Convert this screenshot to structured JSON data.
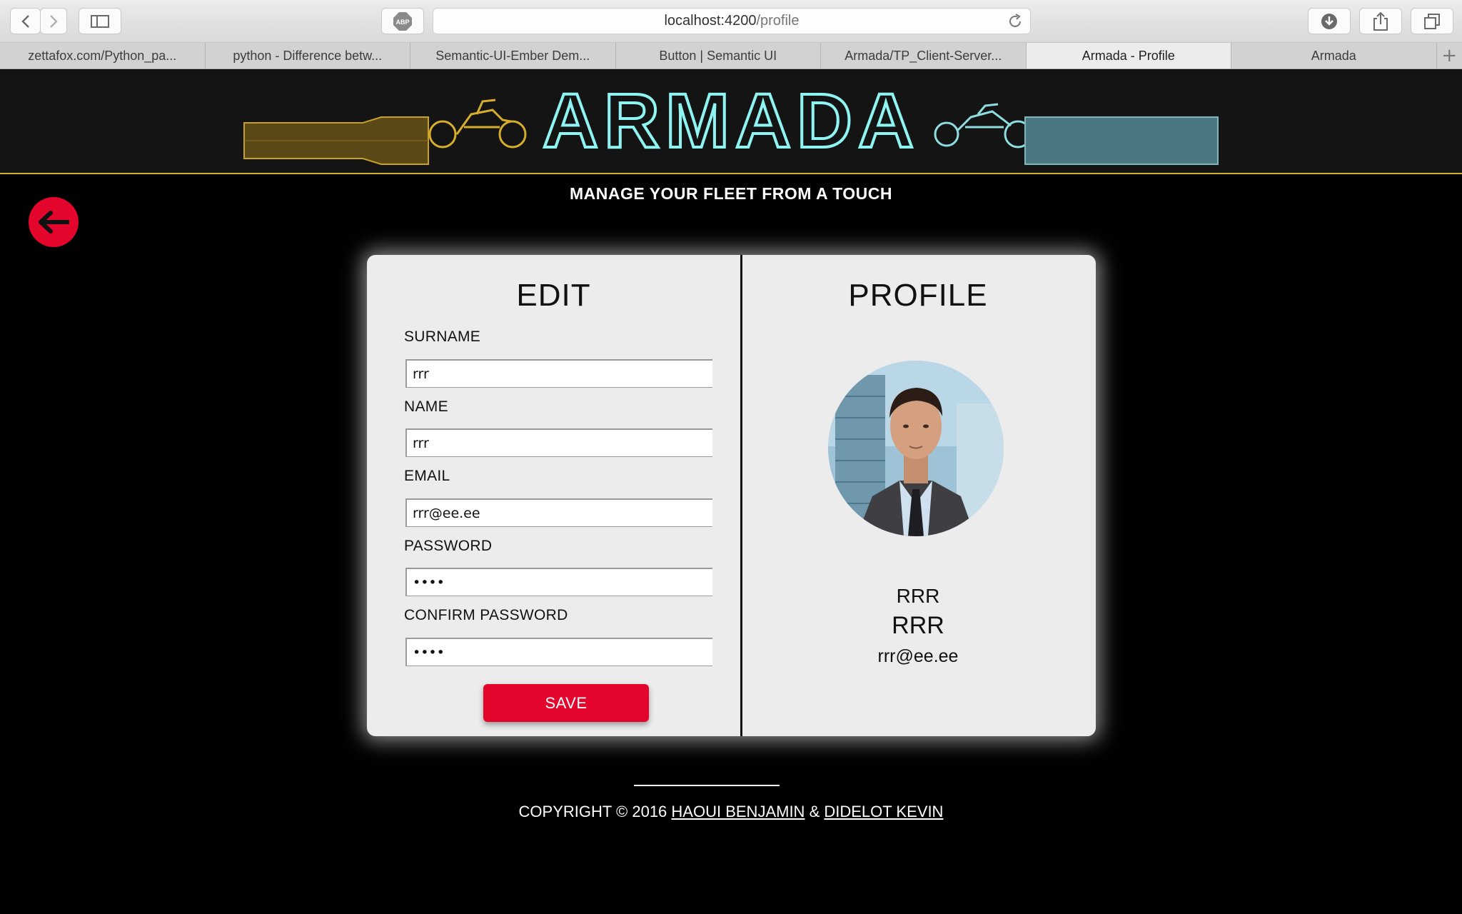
{
  "browser": {
    "url_host": "localhost:4200",
    "url_path": "/profile",
    "tabs": [
      {
        "label": "zettafox.com/Python_pa..."
      },
      {
        "label": "python - Difference betw..."
      },
      {
        "label": "Semantic-UI-Ember Dem..."
      },
      {
        "label": "Button | Semantic UI"
      },
      {
        "label": "Armada/TP_Client-Server..."
      },
      {
        "label": "Armada - Profile",
        "active": true
      },
      {
        "label": "Armada"
      }
    ],
    "add_tab": "+",
    "abp_badge": "ABP"
  },
  "header": {
    "logo_text": "ARMADA",
    "colors": {
      "left_bar": "#c9a02a",
      "logo": "#8ff5f2",
      "right_bar": "#5d8c94",
      "rule": "#d7ad2c"
    }
  },
  "tagline": "MANAGE YOUR FLEET FROM A TOUCH",
  "back_button": {
    "icon": "arrow-left-icon",
    "color": "#e4052c"
  },
  "edit": {
    "title": "EDIT",
    "fields": [
      {
        "label": "SURNAME",
        "value": "rrr"
      },
      {
        "label": "NAME",
        "value": "rrr"
      },
      {
        "label": "EMAIL",
        "value": "rrr@ee.ee"
      },
      {
        "label": "PASSWORD",
        "value": "••••"
      },
      {
        "label": "CONFIRM PASSWORD",
        "value": "••••"
      }
    ],
    "save_label": "SAVE"
  },
  "profile": {
    "title": "PROFILE",
    "surname": "RRR",
    "name": "RRR",
    "email": "rrr@ee.ee"
  },
  "footer": {
    "prefix": "COPYRIGHT © 2016 ",
    "author1": "HAOUI BENJAMIN",
    "separator": " & ",
    "author2": "DIDELOT KEVIN"
  }
}
